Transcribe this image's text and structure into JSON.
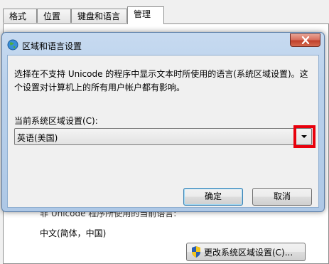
{
  "background": {
    "tabs": [
      "格式",
      "位置",
      "键盘和语言",
      "管理"
    ],
    "active_tab": 3,
    "partial_label": "非 Unicode 程序所使用的当前语言:",
    "current_locale": "中文(简体，中国)",
    "change_locale_button": "更改系统区域设置(C)..."
  },
  "dialog": {
    "title": "区域和语言设置",
    "description_line1": "选择在不支持 Unicode 的程序中显示文本时所使用的语言(系统区域设置)。这",
    "description_line2": "个设置对计算机上的所有用户帐户都有影响。",
    "combo_label": "当前系统区域设置(C):",
    "combo_value": "英语(美国)",
    "ok_label": "确定",
    "cancel_label": "取消",
    "highlight_color": "#e8000c"
  }
}
